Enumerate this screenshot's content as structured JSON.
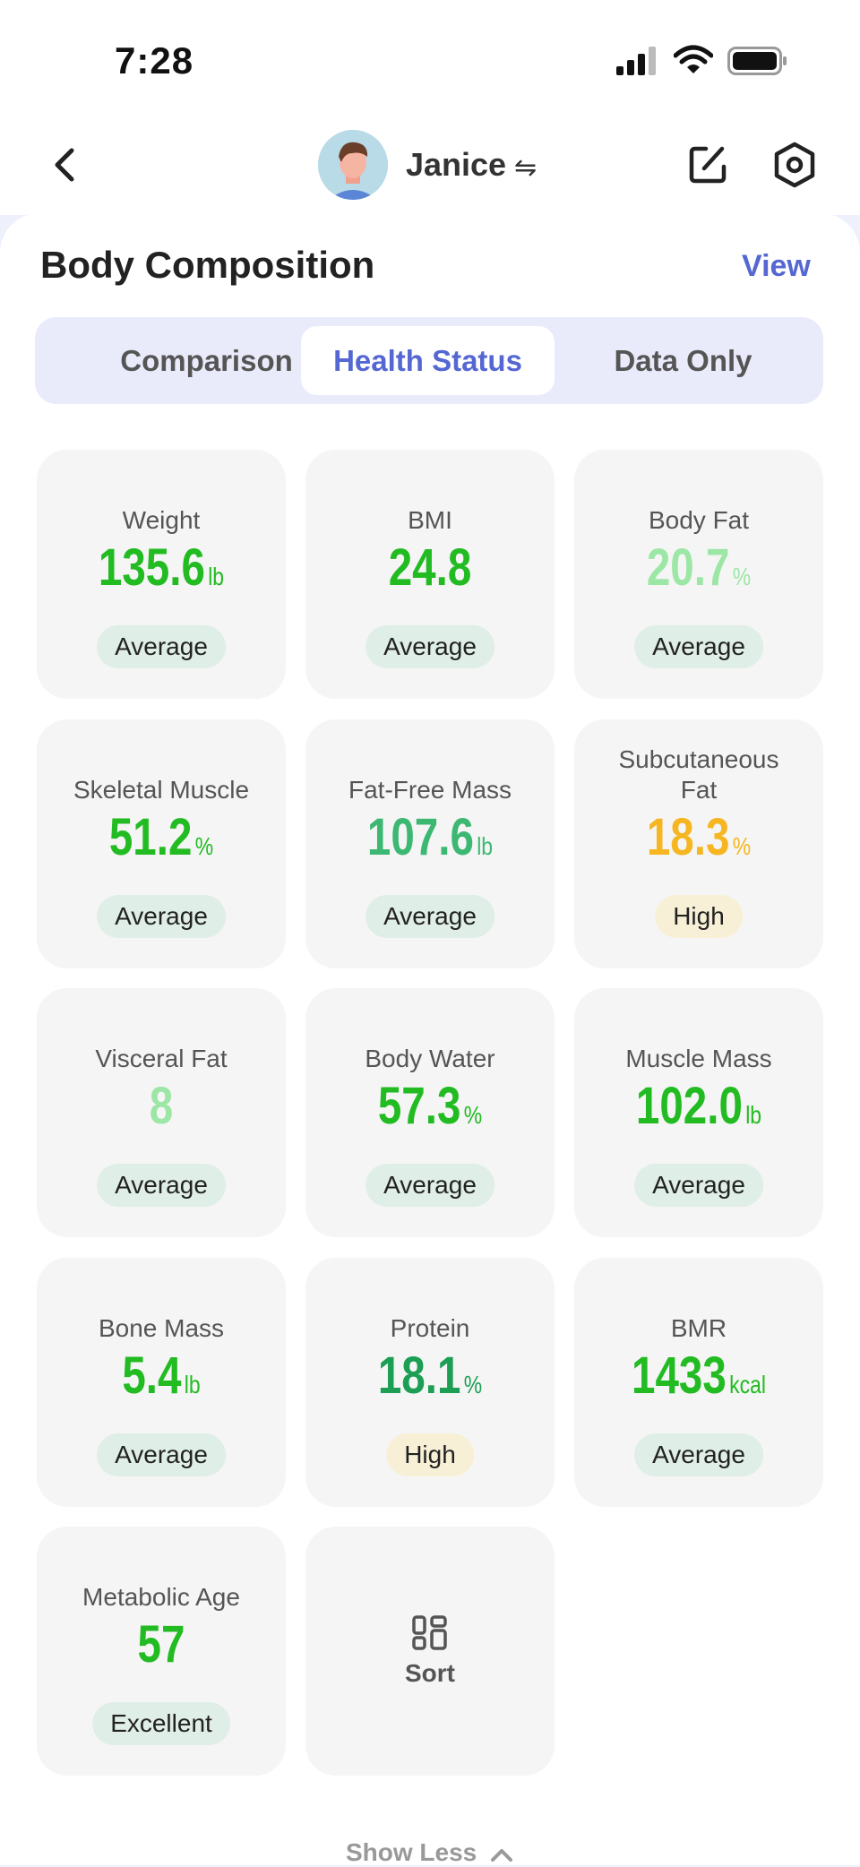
{
  "status_bar": {
    "time": "7:28"
  },
  "nav": {
    "user_name": "Janice",
    "swap_symbol": "⇋"
  },
  "header": {
    "title": "Body Composition",
    "view_label": "View"
  },
  "tabs": [
    {
      "label": "Comparison",
      "active": false
    },
    {
      "label": "Health Status",
      "active": true
    },
    {
      "label": "Data Only",
      "active": false
    }
  ],
  "metrics": [
    {
      "label": "Weight",
      "value": "135.6",
      "unit": "lb",
      "status": "Average",
      "color": "#22bb22"
    },
    {
      "label": "BMI",
      "value": "24.8",
      "unit": "",
      "status": "Average",
      "color": "#22bb22"
    },
    {
      "label": "Body Fat",
      "value": "20.7",
      "unit": "%",
      "status": "Average",
      "color": "#9ce6a6"
    },
    {
      "label": "Skeletal Muscle",
      "value": "51.2",
      "unit": "%",
      "status": "Average",
      "color": "#22bb22"
    },
    {
      "label": "Fat-Free Mass",
      "value": "107.6",
      "unit": "lb",
      "status": "Average",
      "color": "#3cb873"
    },
    {
      "label": "Subcutaneous Fat",
      "value": "18.3",
      "unit": "%",
      "status": "High",
      "color": "#f5b622"
    },
    {
      "label": "Visceral Fat",
      "value": "8",
      "unit": "",
      "status": "Average",
      "color": "#9ce6a6"
    },
    {
      "label": "Body Water",
      "value": "57.3",
      "unit": "%",
      "status": "Average",
      "color": "#22bb22"
    },
    {
      "label": "Muscle Mass",
      "value": "102.0",
      "unit": "lb",
      "status": "Average",
      "color": "#22bb22"
    },
    {
      "label": "Bone Mass",
      "value": "5.4",
      "unit": "lb",
      "status": "Average",
      "color": "#22bb22"
    },
    {
      "label": "Protein",
      "value": "18.1",
      "unit": "%",
      "status": "High",
      "color": "#1c9e55"
    },
    {
      "label": "BMR",
      "value": "1433",
      "unit": "kcal",
      "status": "Average",
      "color": "#22bb22"
    },
    {
      "label": "Metabolic Age",
      "value": "57",
      "unit": "",
      "status": "Excellent",
      "color": "#22bb22"
    }
  ],
  "sort": {
    "label": "Sort"
  },
  "footer": {
    "show_less_label": "Show Less"
  },
  "colors": {
    "accent": "#5567d2",
    "badge_normal": "#dfeee6",
    "badge_high": "#f8f0d6"
  }
}
